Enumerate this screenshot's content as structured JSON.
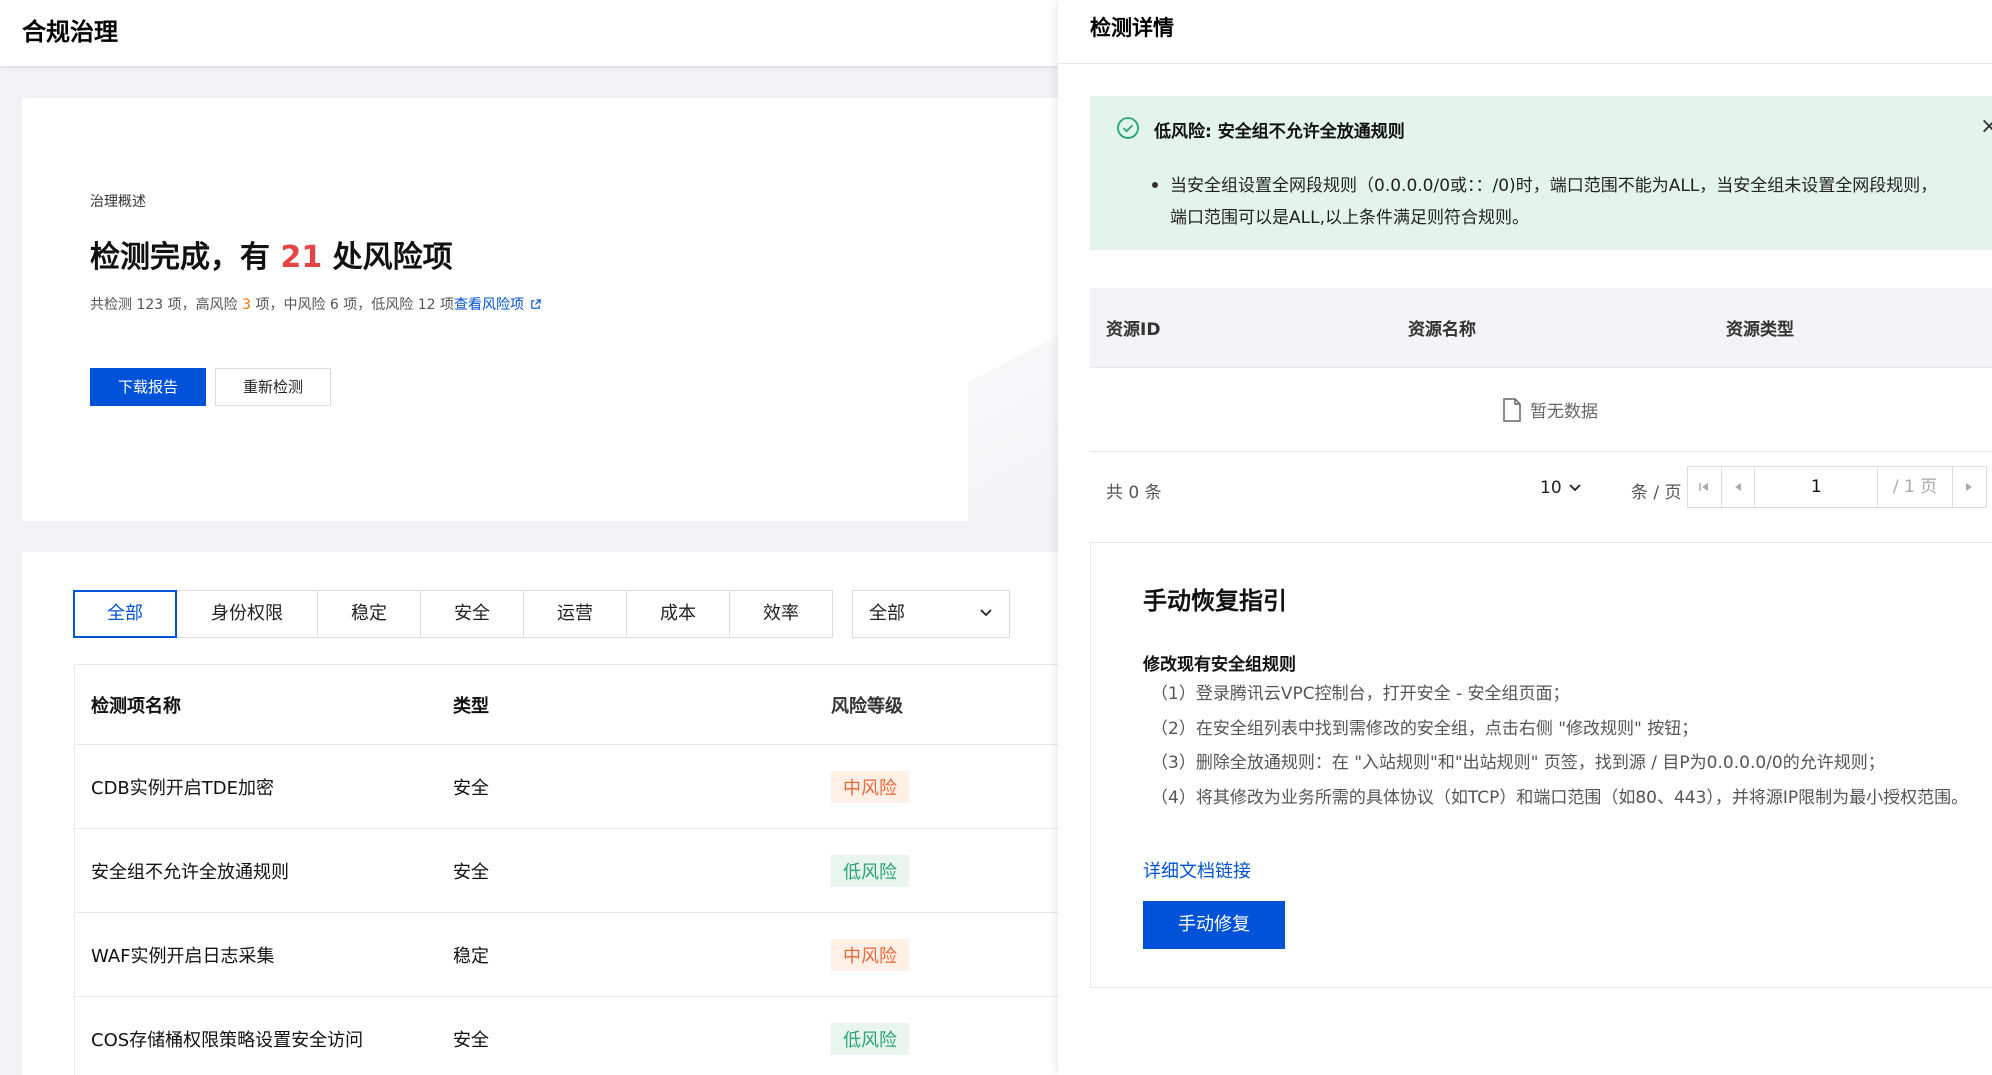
{
  "page": {
    "title": "合规治理",
    "colors": {
      "primary": "#0052d9",
      "danger": "#e54545",
      "warning": "#ff7200",
      "success_bg": "#e3f4ea"
    }
  },
  "overview": {
    "label": "治理概述",
    "headline_prefix": "检测完成，有 ",
    "risk_count": "21",
    "headline_suffix": " 处风险项",
    "stats_a": "共检测 123 项，高风险 ",
    "high_count": "3",
    "stats_b": " 项，中风险 6 项，低风险 12 项",
    "view_link": "查看风险项",
    "download_button": "下载报告",
    "recheck_button": "重新检测"
  },
  "filters": {
    "tabs": [
      "全部",
      "身份权限",
      "稳定",
      "安全",
      "运营",
      "成本",
      "效率"
    ],
    "active_tab": "全部",
    "select_value": "全部"
  },
  "table": {
    "columns": [
      "检测项名称",
      "类型",
      "风险等级"
    ],
    "rows": [
      {
        "name": "CDB实例开启TDE加密",
        "type": "安全",
        "risk": "中风险",
        "level": "mid"
      },
      {
        "name": "安全组不允许全放通规则",
        "type": "安全",
        "risk": "低风险",
        "level": "low"
      },
      {
        "name": "WAF实例开启日志采集",
        "type": "稳定",
        "risk": "中风险",
        "level": "mid"
      },
      {
        "name": "COS存储桶权限策略设置安全访问",
        "type": "安全",
        "risk": "低风险",
        "level": "low"
      }
    ]
  },
  "drawer": {
    "title": "检测详情",
    "alert": {
      "title": "低风险: 安全组不允许全放通规则",
      "text": "当安全组设置全网段规则（0.0.0.0/0或：：/0)时，端口范围不能为ALL，当安全组未设置全网段规则，端口范围可以是ALL,以上条件满足则符合规则。",
      "close": "×"
    },
    "resource_table": {
      "columns": [
        "资源ID",
        "资源名称",
        "资源类型"
      ],
      "empty_text": "暂无数据"
    },
    "pagination": {
      "total": "共 0 条",
      "page_size": "10",
      "page_size_unit": "条 / 页",
      "current_page": "1",
      "total_pages": "/ 1 页"
    },
    "guide": {
      "title": "手动恢复指引",
      "subtitle": "修改现有安全组规则",
      "steps": [
        "（1）登录腾讯云VPC控制台，打开安全 - 安全组页面；",
        "（2）在安全组列表中找到需修改的安全组，点击右侧 \"修改规则\" 按钮；",
        "（3）删除全放通规则：在 \"入站规则\"和\"出站规则\" 页签，找到源 / 目P为0.0.0.0/0的允许规则；",
        "（4）将其修改为业务所需的具体协议（如TCP）和端口范围（如80、443），并将源IP限制为最小授权范围。"
      ],
      "doc_link": "详细文档链接",
      "fix_button": "手动修复"
    }
  }
}
